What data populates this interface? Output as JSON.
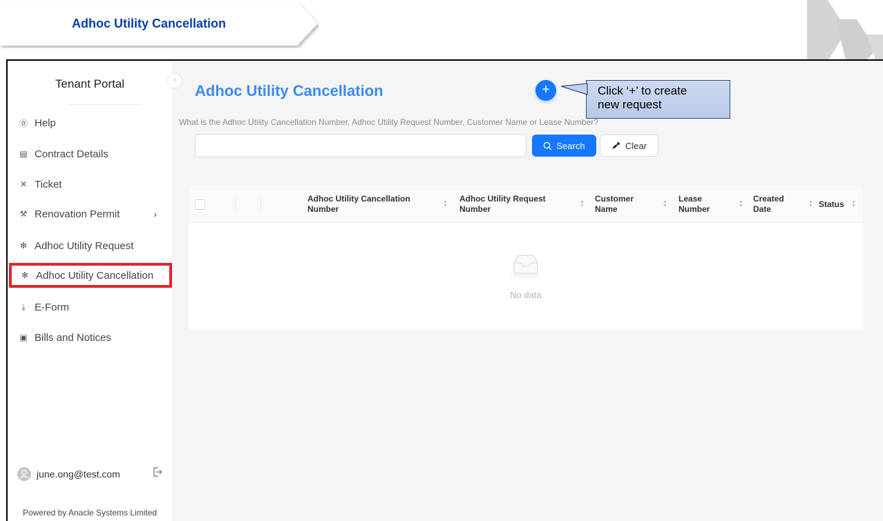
{
  "slide": {
    "title": "Adhoc Utility Cancellation"
  },
  "sidebar": {
    "app_title": "Tenant Portal",
    "items": [
      {
        "label": "Help",
        "icon": "question-circle-icon",
        "glyph": "⓪"
      },
      {
        "label": "Contract Details",
        "icon": "document-icon",
        "glyph": "▤"
      },
      {
        "label": "Ticket",
        "icon": "tools-icon",
        "glyph": "✕"
      },
      {
        "label": "Renovation Permit",
        "icon": "renovation-icon",
        "glyph": "⚒",
        "arrow": "›"
      },
      {
        "label": "Adhoc Utility Request",
        "icon": "utility-icon",
        "glyph": "✻"
      },
      {
        "label": "Adhoc Utility Cancellation",
        "icon": "utility-icon",
        "glyph": "✻"
      },
      {
        "label": "E-Form",
        "icon": "download-icon",
        "glyph": "⤓"
      },
      {
        "label": "Bills and Notices",
        "icon": "bill-icon",
        "glyph": "▣"
      }
    ],
    "active_item": "Adhoc Utility Cancellation",
    "collapse_glyph": "‹",
    "user_email": "june.ong@test.com",
    "powered_by": "Powered by Anacle Systems Limited"
  },
  "main": {
    "title": "Adhoc Utility Cancellation",
    "add_glyph": "+",
    "search_hint": "What is the Adhoc Utility Cancellation Number, Adhoc Utility Request Number, Customer Name or Lease Number?",
    "search_value": "",
    "search_button": "Search",
    "clear_button": "Clear"
  },
  "callout": {
    "line1": "Click ‘+’ to create",
    "line2": "new request"
  },
  "table": {
    "columns": [
      {
        "line1": "Adhoc Utility Cancellation",
        "line2": "Number"
      },
      {
        "line1": "Adhoc Utility Request",
        "line2": "Number"
      },
      {
        "line1": "Customer",
        "line2": "Name"
      },
      {
        "line1": "Lease",
        "line2": "Number"
      },
      {
        "line1": "Created",
        "line2": "Date"
      },
      {
        "line1": "Status",
        "line2": ""
      }
    ],
    "rows": [],
    "empty_text": "No data"
  },
  "colors": {
    "accent": "#1677ff",
    "title_blue": "#3a8bf0",
    "highlight_red": "#e8212b",
    "slide_title_blue": "#0b3fa6",
    "callout_fill": "#c4d1ec"
  }
}
